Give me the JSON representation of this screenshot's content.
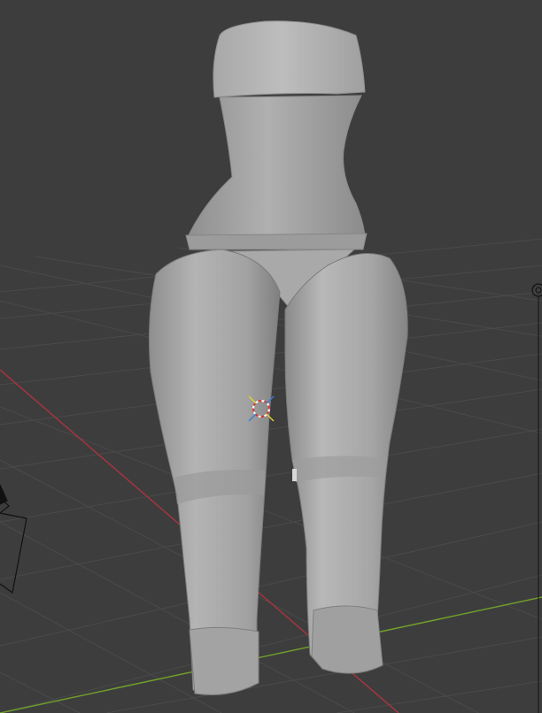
{
  "viewport": {
    "mode": "3D Viewport",
    "shading": "solid",
    "background_color": "#3d3d3d",
    "grid_color": "#4c4c4c",
    "x_axis_color": "#a3353f",
    "y_axis_color": "#6f9c2c",
    "mesh_color": "#a6a6a6"
  },
  "objects": {
    "mesh": {
      "shape": "low-poly body (torso, hips, legs)",
      "wireframe": false
    },
    "cursor_3d": {
      "icon": "3d-cursor-icon"
    },
    "camera": {
      "icon": "camera-icon",
      "visible": "partial"
    },
    "light": {
      "icon": "light-icon",
      "visible": "partial"
    }
  }
}
